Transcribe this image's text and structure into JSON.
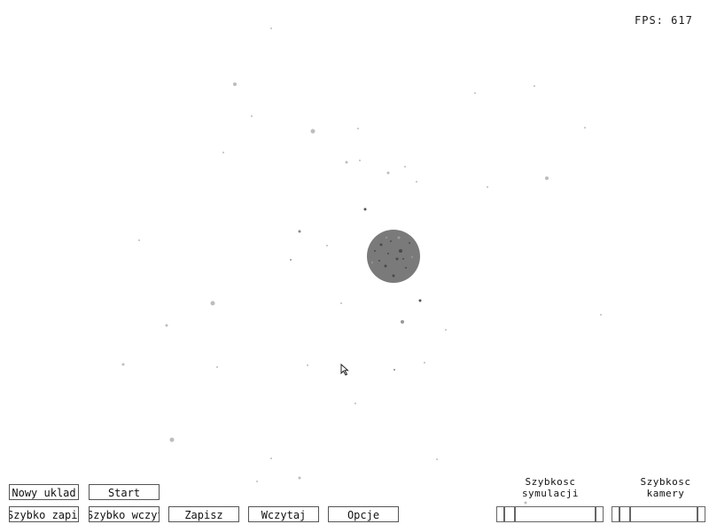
{
  "hud": {
    "fps_text": "FPS: 617"
  },
  "toolbar": {
    "new_system_label": "Nowy uklad",
    "start_label": "Start",
    "quick_save_label": "Szybko zapisz",
    "quick_load_label": "Szybko wczytaj",
    "save_label": "Zapisz",
    "load_label": "Wczytaj",
    "options_label": "Opcje"
  },
  "sliders": {
    "sim_speed": {
      "label_line1": "Szybkosc",
      "label_line2": "symulacji"
    },
    "camera_speed": {
      "label_line1": "Szybkosc",
      "label_line2": "kamery"
    }
  },
  "scene": {
    "planet_icon": "planet-icon",
    "planet_color": "#7a7a7a",
    "background_color": "#ffffff"
  }
}
